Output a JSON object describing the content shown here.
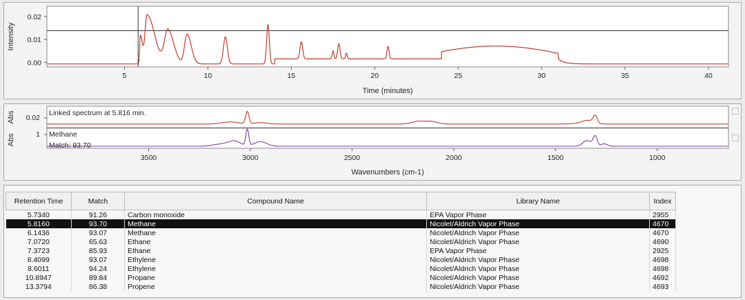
{
  "colors": {
    "chromatogram_line": "#c0392b",
    "sample_spectrum_line": "#c0392b",
    "library_spectrum_line": "#7b3fa0",
    "selected_row_bg": "#111111",
    "selected_row_text": "#ffffff"
  },
  "chromatogram": {
    "ylabel": "Intensity",
    "xlabel": "Time (minutes)",
    "y_ticks": [
      "0.02",
      "0.01",
      "0.00"
    ],
    "x_ticks": [
      "5",
      "10",
      "15",
      "20",
      "25",
      "30",
      "35",
      "40"
    ],
    "cursor_time": 5.816,
    "threshold": 0.0138
  },
  "spectrum": {
    "sample_ylabel": "Abs",
    "sample_y_tick": "0.02",
    "sample_label": "Linked spectrum at 5.816 min.",
    "library_ylabel": "Abs",
    "library_y_tick": "1",
    "library_label": "Methane",
    "match_label": "Match:  93.70",
    "xlabel": "Wavenumbers (cm-1)",
    "x_ticks": [
      "3500",
      "3000",
      "2500",
      "2000",
      "1500",
      "1000"
    ]
  },
  "results_table": {
    "columns": [
      "Retention Time",
      "Match",
      "Compound Name",
      "Library Name",
      "Index"
    ],
    "rows": [
      {
        "retention_time": "5.7340",
        "match": "91.26",
        "compound": "Carbon monoxide",
        "library": "EPA Vapor Phase",
        "index": "2955"
      },
      {
        "retention_time": "5.8160",
        "match": "93.70",
        "compound": "Methane",
        "library": "Nicolet/Aldrich Vapor Phase",
        "index": "4670"
      },
      {
        "retention_time": "6.1436",
        "match": "93.07",
        "compound": "Methane",
        "library": "Nicolet/Aldrich Vapor Phase",
        "index": "4670"
      },
      {
        "retention_time": "7.0720",
        "match": "65.63",
        "compound": "Ethane",
        "library": "Nicolet/Aldrich Vapor Phase",
        "index": "4690"
      },
      {
        "retention_time": "7.3723",
        "match": "85.93",
        "compound": "Ethane",
        "library": "EPA Vapor Phase",
        "index": "2925"
      },
      {
        "retention_time": "8.4099",
        "match": "93.07",
        "compound": "Ethylene",
        "library": "Nicolet/Aldrich Vapor Phase",
        "index": "4698"
      },
      {
        "retention_time": "8.6011",
        "match": "94.24",
        "compound": "Ethylene",
        "library": "Nicolet/Aldrich Vapor Phase",
        "index": "4698"
      },
      {
        "retention_time": "10.8947",
        "match": "89.84",
        "compound": "Propane",
        "library": "Nicolet/Aldrich Vapor Phase",
        "index": "4692"
      },
      {
        "retention_time": "13.3794",
        "match": "86.38",
        "compound": "Propene",
        "library": "Nicolet/Aldrich Vapor Phase",
        "index": "4693"
      }
    ],
    "selected_row": 1
  }
}
